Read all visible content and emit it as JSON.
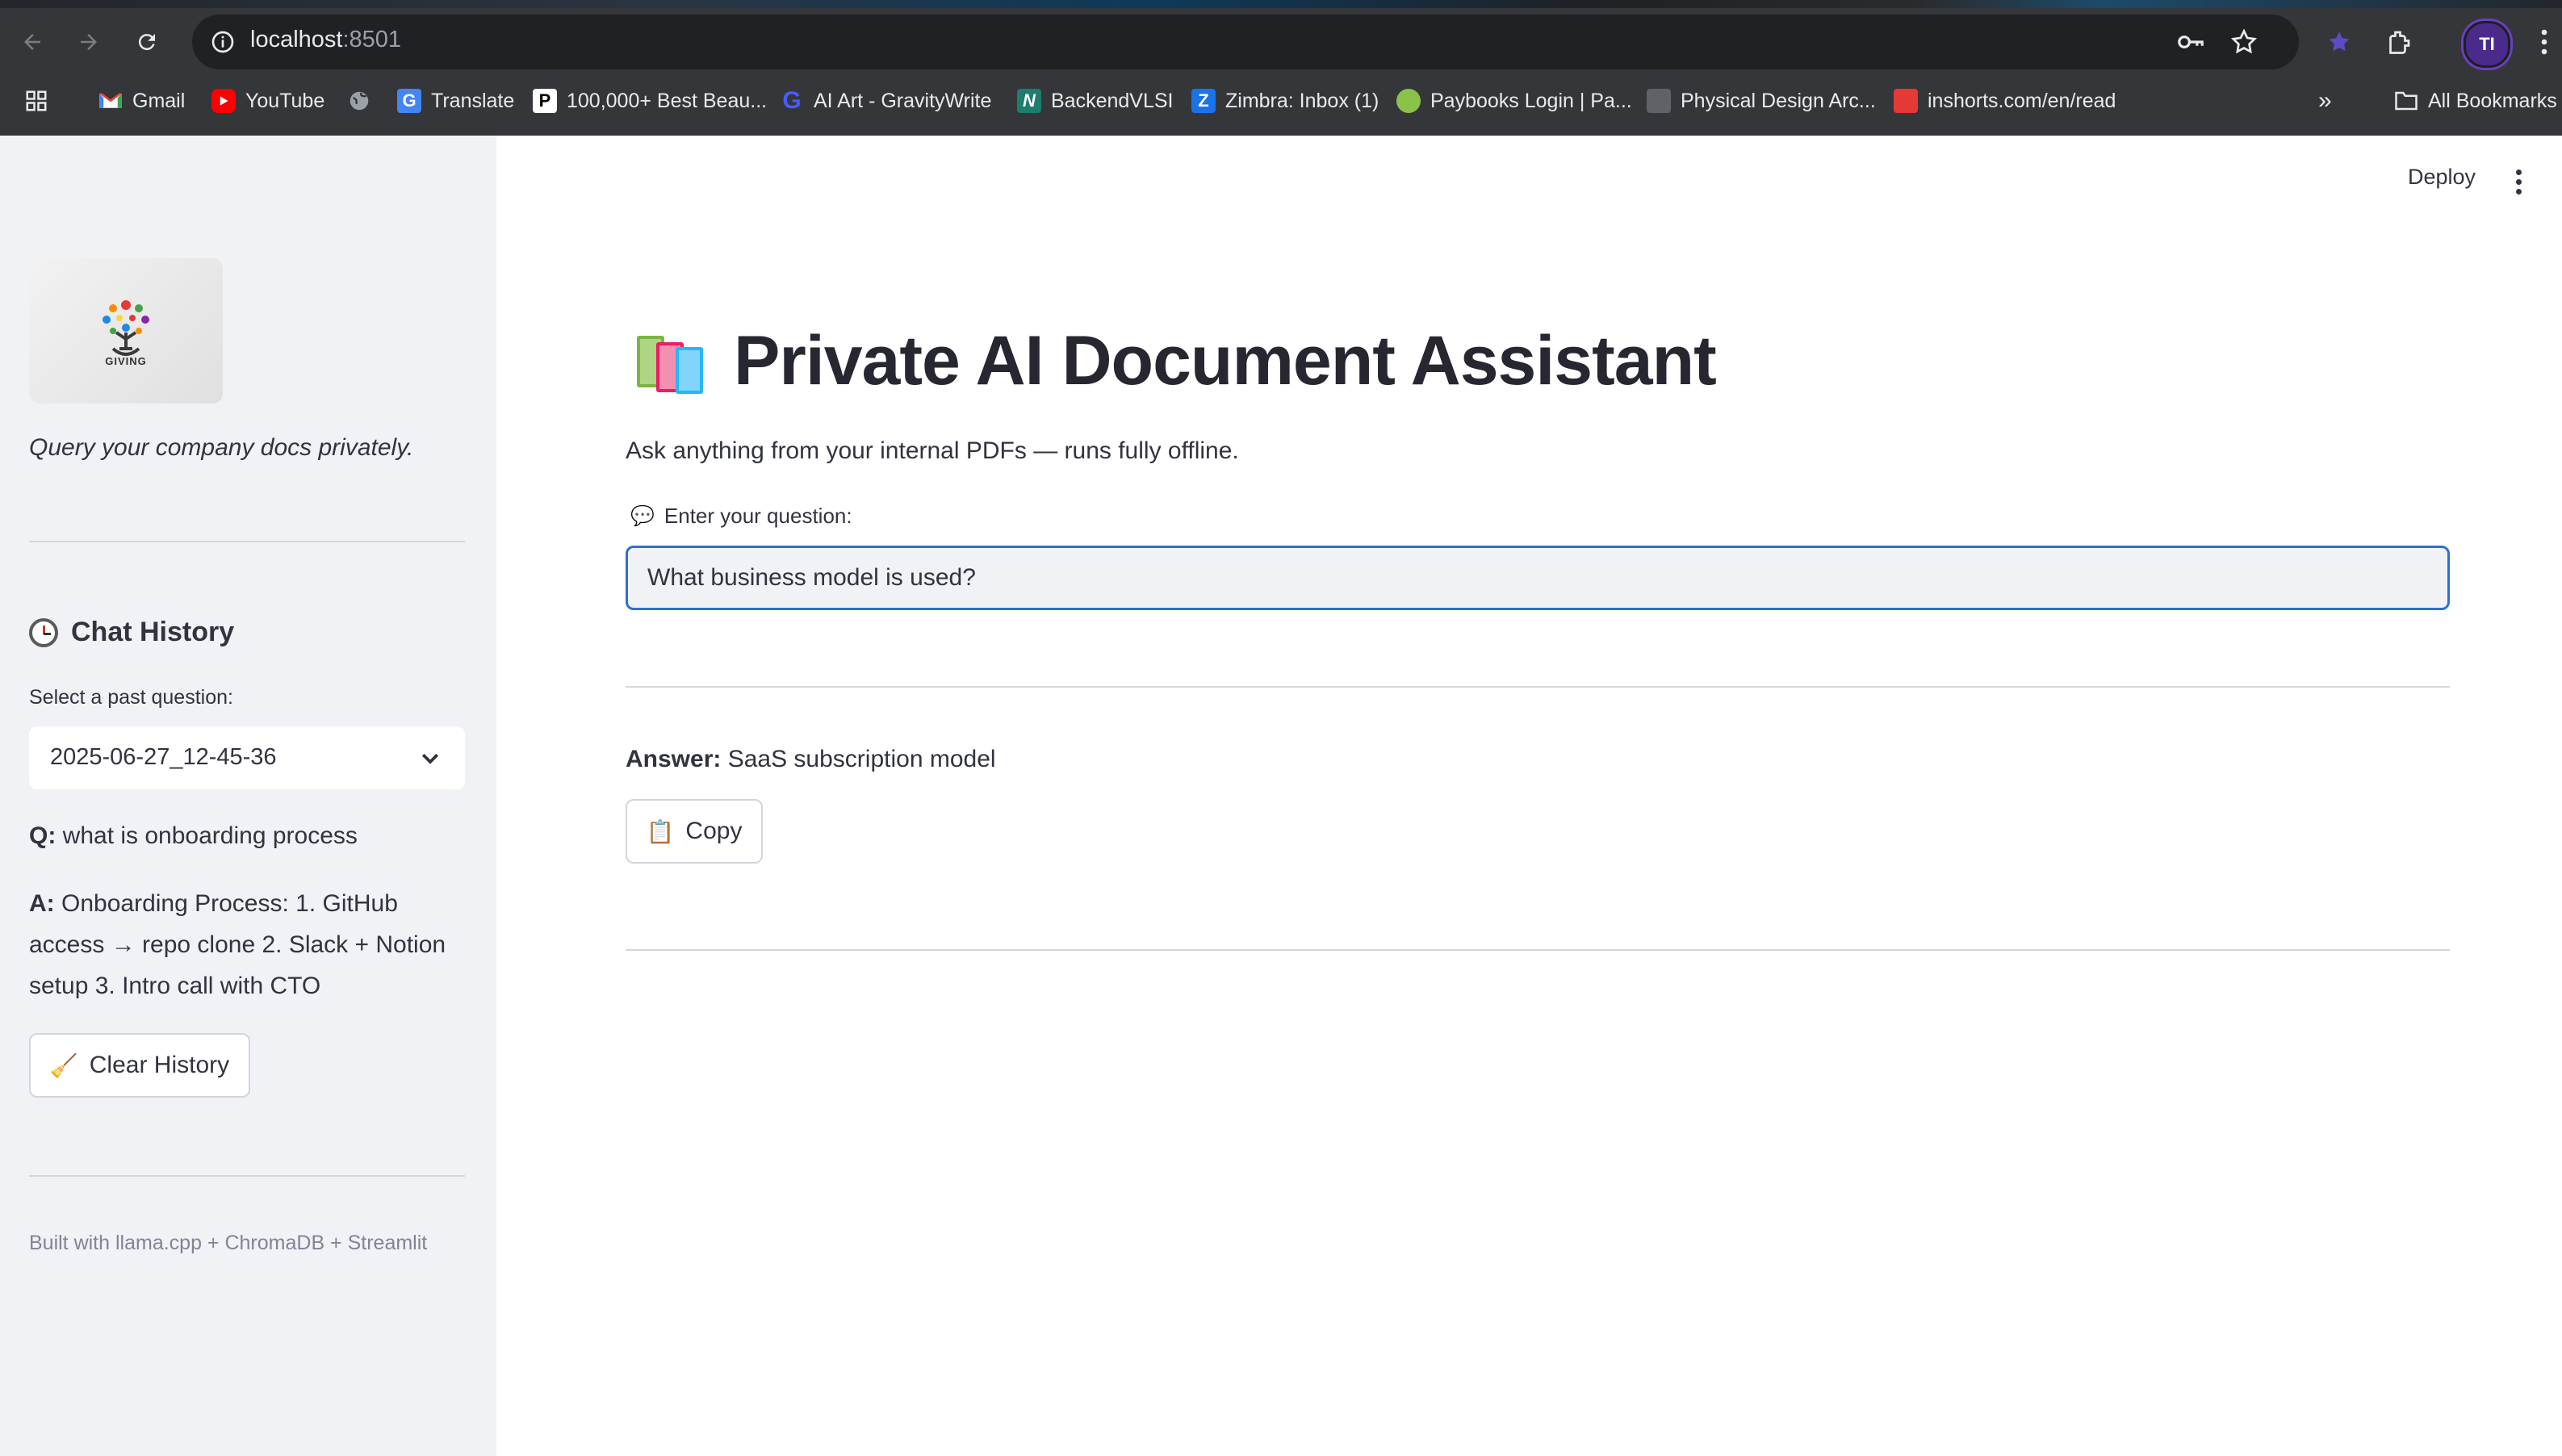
{
  "browser": {
    "url_host": "localhost",
    "url_port": ":8501",
    "profile_initials": "TI",
    "bookmarks": [
      {
        "label": "Gmail",
        "icon": "gmail-icon"
      },
      {
        "label": "YouTube",
        "icon": "youtube-icon"
      },
      {
        "label": "",
        "icon": "globe-icon"
      },
      {
        "label": "Translate",
        "icon": "translate-icon"
      },
      {
        "label": "100,000+ Best Beau...",
        "icon": "pexels-icon"
      },
      {
        "label": "AI Art - GravityWrite",
        "icon": "gravitywrite-icon"
      },
      {
        "label": "BackendVLSI",
        "icon": "backendvlsi-icon"
      },
      {
        "label": "Zimbra: Inbox (1)",
        "icon": "zimbra-icon"
      },
      {
        "label": "Paybooks Login | Pa...",
        "icon": "paybooks-icon"
      },
      {
        "label": "Physical Design Arc...",
        "icon": "document-icon"
      },
      {
        "label": "inshorts.com/en/read",
        "icon": "inshorts-icon"
      }
    ],
    "all_bookmarks_label": "All Bookmarks"
  },
  "sidebar": {
    "logo_text": "GIVING",
    "tagline": "Query your company docs privately.",
    "history_heading": "Chat History",
    "select_label": "Select a past question:",
    "selected_value": "2025-06-27_12-45-36",
    "q_prefix": "Q:",
    "q_text": "what is onboarding process",
    "a_prefix": "A:",
    "a_text": "Onboarding Process: 1. GitHub access → repo clone 2. Slack + Notion setup 3. Intro call with CTO",
    "clear_button": "Clear History",
    "footnote": "Built with llama.cpp + ChromaDB + Streamlit"
  },
  "main": {
    "deploy_label": "Deploy",
    "title": "Private AI Document Assistant",
    "subtitle": "Ask anything from your internal PDFs — runs fully offline.",
    "question_label": "Enter your question:",
    "question_value": "What business model is used?",
    "answer_prefix": "Answer:",
    "answer_text": "SaaS subscription model",
    "copy_button": "Copy"
  },
  "colors": {
    "accent_focus": "#2f6fd0",
    "sidebar_bg": "#f0f2f6",
    "browser_bg": "#35363a"
  }
}
